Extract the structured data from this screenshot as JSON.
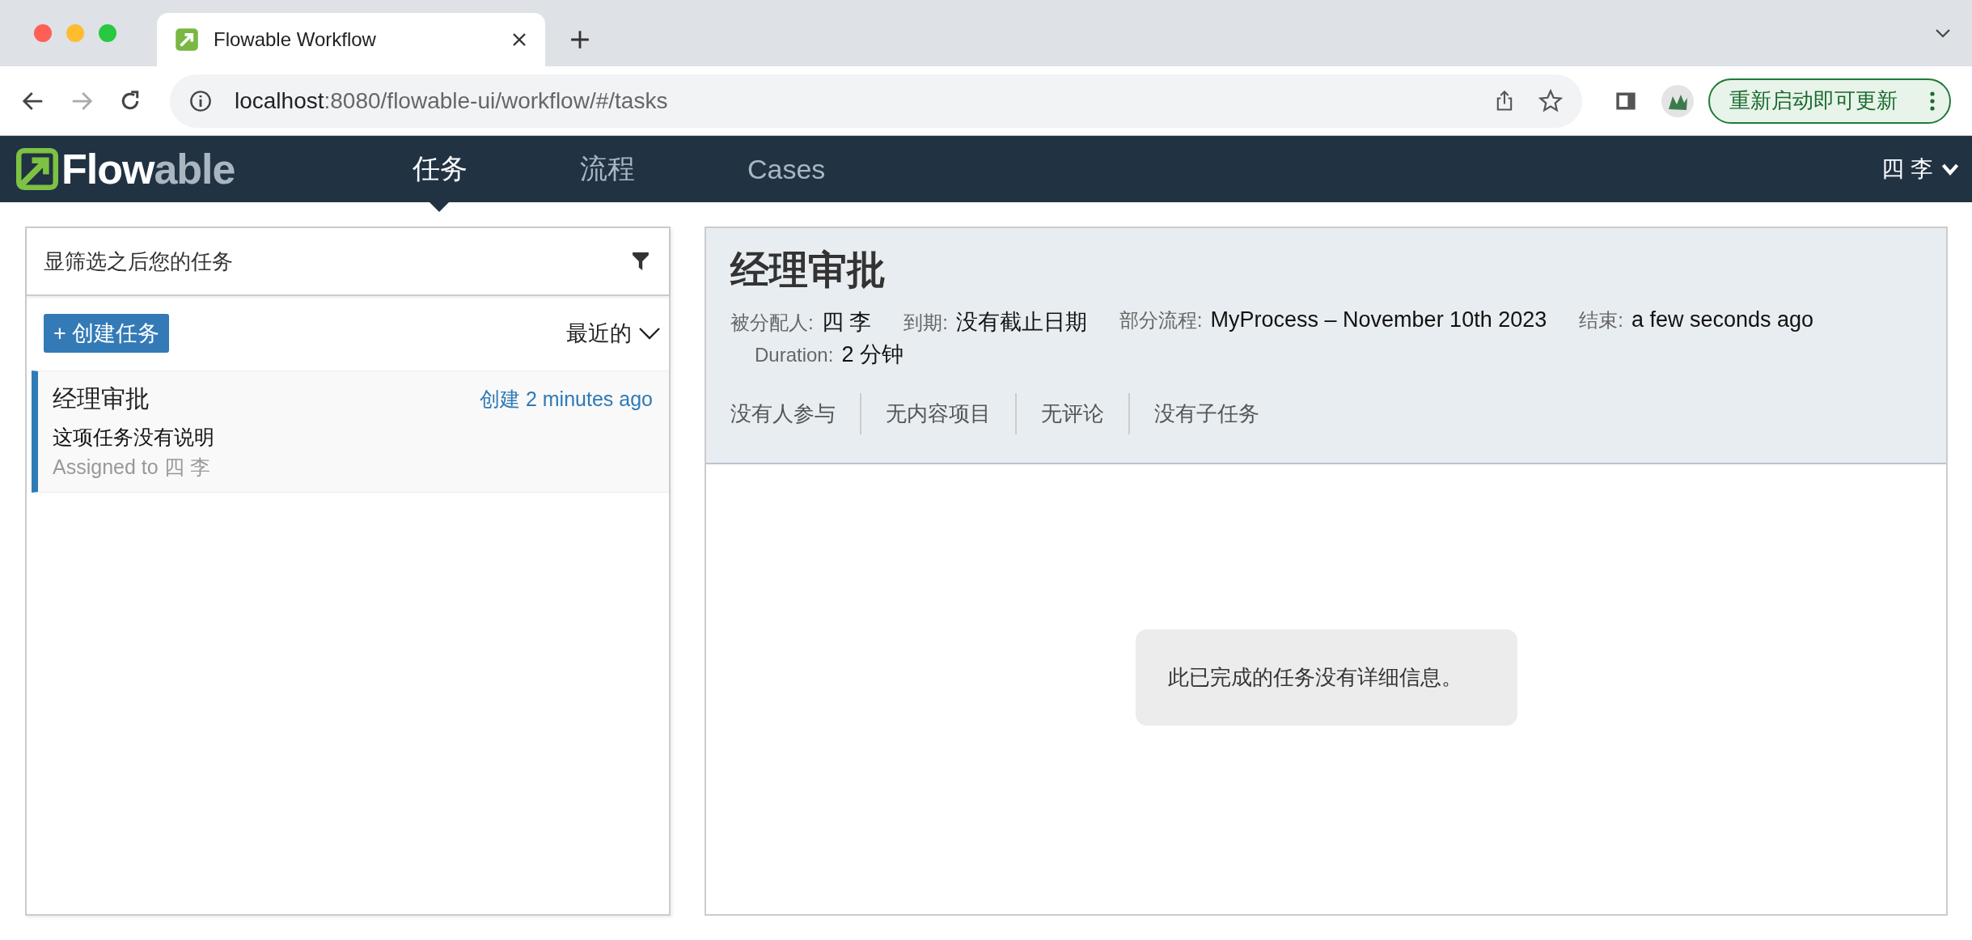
{
  "browser": {
    "tab_title": "Flowable Workflow",
    "url_host": "localhost",
    "url_path": ":8080/flowable-ui/workflow/#/tasks",
    "update_button": "重新启动即可更新"
  },
  "navbar": {
    "logo": [
      "Flow",
      "able"
    ],
    "items": [
      {
        "label": "任务",
        "selected": true
      },
      {
        "label": "流程",
        "selected": false
      },
      {
        "label": "Cases",
        "selected": false
      }
    ],
    "user_menu": "四 李"
  },
  "task_list": {
    "filter_title": "显筛选之后您的任务",
    "create_button": "+ 创建任务",
    "sort": "最近的",
    "tasks": [
      {
        "title": "经理审批",
        "created": "创建 2 minutes ago",
        "description": "这项任务没有说明",
        "assignee": "Assigned to 四 李",
        "selected": true
      }
    ]
  },
  "task_detail": {
    "title": "经理审批",
    "meta": [
      {
        "label": "被分配人:",
        "value": "四 李"
      },
      {
        "label": "到期:",
        "value": "没有截止日期"
      },
      {
        "label": "部分流程:",
        "value": "MyProcess – November 10th 2023"
      },
      {
        "label": "结束:",
        "value": "a few seconds ago"
      },
      {
        "label": "Duration:",
        "value": "2 分钟"
      }
    ],
    "tabs": [
      "没有人参与",
      "无内容项目",
      "无评论",
      "没有子任务"
    ],
    "message": "此已完成的任务没有详细信息。"
  }
}
